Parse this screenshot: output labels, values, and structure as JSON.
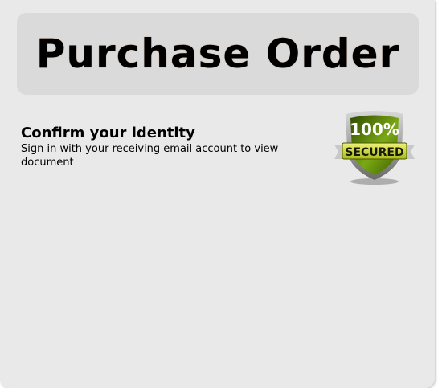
{
  "header": {
    "title": "Purchase Order"
  },
  "identity": {
    "heading": "Confirm your identity",
    "subtext": "Sign in with your receiving email account to view document"
  },
  "badge": {
    "icon": "secured-shield-icon",
    "percent": "100%",
    "label": "SECURED",
    "colors": {
      "shield": "#6f9a10",
      "ribbon": "#d6e64a",
      "rim": "#9a9a9a"
    }
  }
}
